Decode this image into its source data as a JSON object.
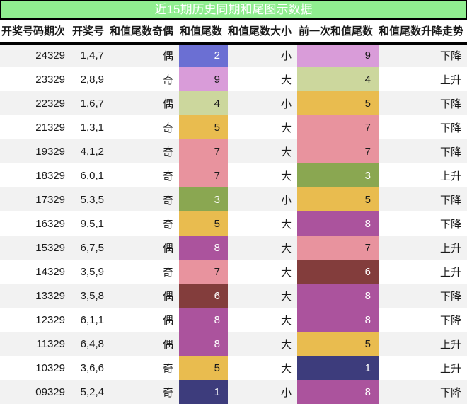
{
  "title": "近15期历史同期和尾图示数据",
  "colors": {
    "title_bg": "#90ee90",
    "title_text": "#ffffff",
    "border": "#000000",
    "row_alt_bg": "#f2f2f2",
    "row_bg": "#ffffff",
    "text": "#1a1a1a"
  },
  "chart_data": {
    "type": "table",
    "title": "近15期历史同期和尾图示数据",
    "columns": [
      "开奖号码期次",
      "开奖号",
      "和值尾数奇偶",
      "和值尾数",
      "和值尾数大小",
      "前一次和值尾数",
      "和值尾数升降走势"
    ],
    "tail_color_map": {
      "1": {
        "bg": "#3d3c7c",
        "text": "#ffffff"
      },
      "2": {
        "bg": "#6b6fd3",
        "text": "#ffffff"
      },
      "3": {
        "bg": "#8aa751",
        "text": "#ffffff"
      },
      "4": {
        "bg": "#ccd79d",
        "text": "#1a1a1a"
      },
      "5": {
        "bg": "#e9bc4f",
        "text": "#1a1a1a"
      },
      "6": {
        "bg": "#833d3c",
        "text": "#ffffff"
      },
      "7": {
        "bg": "#e8939e",
        "text": "#1a1a1a"
      },
      "8": {
        "bg": "#ab539d",
        "text": "#ffffff"
      },
      "9": {
        "bg": "#d99cd9",
        "text": "#1a1a1a"
      }
    },
    "rows": [
      {
        "period": "24329",
        "numbers": "1,4,7",
        "parity": "偶",
        "tail": "2",
        "size": "小",
        "prev_tail": "9",
        "trend": "下降"
      },
      {
        "period": "23329",
        "numbers": "2,8,9",
        "parity": "奇",
        "tail": "9",
        "size": "大",
        "prev_tail": "4",
        "trend": "上升"
      },
      {
        "period": "22329",
        "numbers": "1,6,7",
        "parity": "偶",
        "tail": "4",
        "size": "小",
        "prev_tail": "5",
        "trend": "下降"
      },
      {
        "period": "21329",
        "numbers": "1,3,1",
        "parity": "奇",
        "tail": "5",
        "size": "大",
        "prev_tail": "7",
        "trend": "下降"
      },
      {
        "period": "19329",
        "numbers": "4,1,2",
        "parity": "奇",
        "tail": "7",
        "size": "大",
        "prev_tail": "7",
        "trend": "下降"
      },
      {
        "period": "18329",
        "numbers": "6,0,1",
        "parity": "奇",
        "tail": "7",
        "size": "大",
        "prev_tail": "3",
        "trend": "上升"
      },
      {
        "period": "17329",
        "numbers": "5,3,5",
        "parity": "奇",
        "tail": "3",
        "size": "小",
        "prev_tail": "5",
        "trend": "下降"
      },
      {
        "period": "16329",
        "numbers": "9,5,1",
        "parity": "奇",
        "tail": "5",
        "size": "大",
        "prev_tail": "8",
        "trend": "下降"
      },
      {
        "period": "15329",
        "numbers": "6,7,5",
        "parity": "偶",
        "tail": "8",
        "size": "大",
        "prev_tail": "7",
        "trend": "上升"
      },
      {
        "period": "14329",
        "numbers": "3,5,9",
        "parity": "奇",
        "tail": "7",
        "size": "大",
        "prev_tail": "6",
        "trend": "上升"
      },
      {
        "period": "13329",
        "numbers": "3,5,8",
        "parity": "偶",
        "tail": "6",
        "size": "大",
        "prev_tail": "8",
        "trend": "下降"
      },
      {
        "period": "12329",
        "numbers": "6,1,1",
        "parity": "偶",
        "tail": "8",
        "size": "大",
        "prev_tail": "8",
        "trend": "下降"
      },
      {
        "period": "11329",
        "numbers": "6,4,8",
        "parity": "偶",
        "tail": "8",
        "size": "大",
        "prev_tail": "5",
        "trend": "上升"
      },
      {
        "period": "10329",
        "numbers": "3,6,6",
        "parity": "奇",
        "tail": "5",
        "size": "大",
        "prev_tail": "1",
        "trend": "上升"
      },
      {
        "period": "09329",
        "numbers": "5,2,4",
        "parity": "奇",
        "tail": "1",
        "size": "小",
        "prev_tail": "8",
        "trend": "下降"
      }
    ]
  }
}
